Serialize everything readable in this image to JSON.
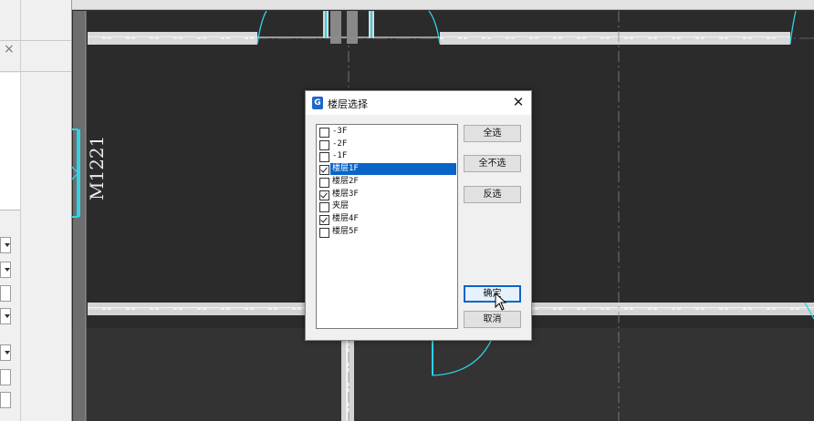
{
  "canvas": {
    "door_label": "M1221"
  },
  "dialog": {
    "title": "楼层选择",
    "floors": [
      {
        "label": "-3F",
        "checked": false,
        "selected": false
      },
      {
        "label": "-2F",
        "checked": false,
        "selected": false
      },
      {
        "label": "-1F",
        "checked": false,
        "selected": false
      },
      {
        "label": "楼层1F",
        "checked": true,
        "selected": true
      },
      {
        "label": "楼层2F",
        "checked": false,
        "selected": false
      },
      {
        "label": "楼层3F",
        "checked": true,
        "selected": false
      },
      {
        "label": "夹层",
        "checked": false,
        "selected": false
      },
      {
        "label": "楼层4F",
        "checked": true,
        "selected": false
      },
      {
        "label": "楼层5F",
        "checked": false,
        "selected": false
      }
    ],
    "buttons": {
      "select_all": "全选",
      "select_none": "全不选",
      "invert": "反选",
      "ok": "确定",
      "cancel": "取消"
    }
  },
  "colors": {
    "canvas_bg": "#2b2b2b",
    "door": "#2ed3e6",
    "selection": "#0a64c8"
  }
}
